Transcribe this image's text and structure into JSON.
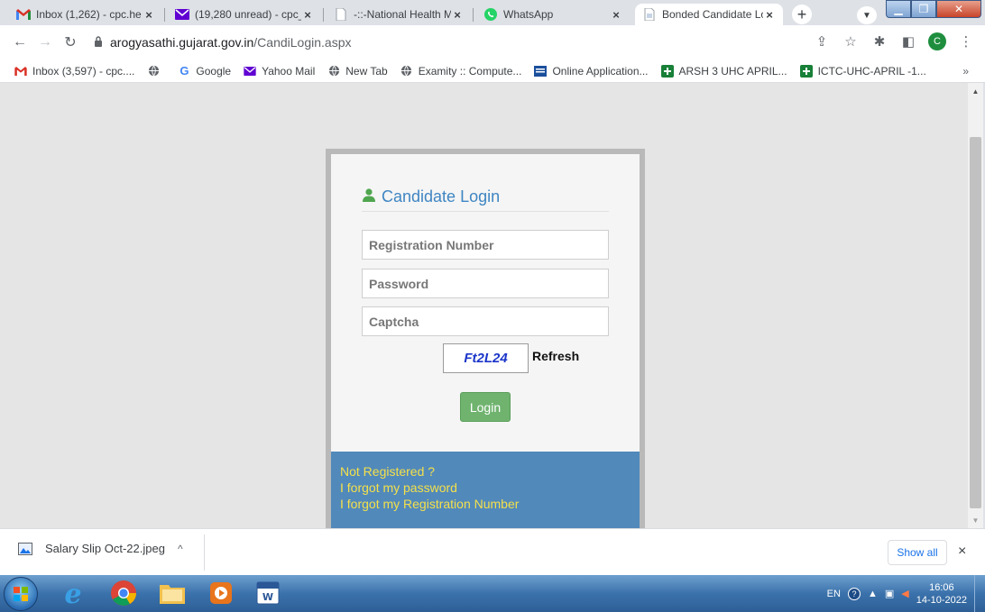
{
  "tabs": [
    {
      "label": "Inbox (1,262) - cpc.he",
      "close": "×",
      "icon": "gmail-icon"
    },
    {
      "label": "(19,280 unread) - cpc_",
      "close": "×",
      "icon": "yahoo-mail-icon"
    },
    {
      "label": "-::-National Health Mi",
      "close": "×",
      "icon": "document-icon"
    },
    {
      "label": "WhatsApp",
      "close": "×",
      "icon": "whatsapp-icon"
    },
    {
      "label": "Bonded Candidate Lo",
      "close": "×",
      "icon": "document-icon"
    }
  ],
  "new_tab": "+",
  "address": {
    "host": "arogyasathi.gujarat.gov.in",
    "path": "/CandiLogin.aspx"
  },
  "profile_initial": "C",
  "bookmarks": [
    {
      "label": "Inbox (3,597) - cpc....",
      "icon": "gmail-icon"
    },
    {
      "label": "",
      "icon": "globe-icon"
    },
    {
      "label": "Google",
      "icon": "google-icon"
    },
    {
      "label": "Yahoo Mail",
      "icon": "yahoo-mail-icon"
    },
    {
      "label": "New Tab",
      "icon": "globe-icon"
    },
    {
      "label": "Examity :: Compute...",
      "icon": "globe-icon"
    },
    {
      "label": "Online Application...",
      "icon": "form-icon"
    },
    {
      "label": "ARSH 3 UHC APRIL...",
      "icon": "sheets-icon"
    },
    {
      "label": "ICTC-UHC-APRIL -1...",
      "icon": "sheets-icon"
    }
  ],
  "bookmarks_more": "»",
  "login": {
    "title": "Candidate Login",
    "registration_placeholder": "Registration Number",
    "password_placeholder": "Password",
    "captcha_placeholder": "Captcha",
    "captcha_text": "Ft2L24",
    "refresh_label": "Refresh",
    "login_label": "Login",
    "links": [
      "Not Registered ?",
      "I forgot my password",
      "I forgot my Registration Number"
    ]
  },
  "downloads": {
    "file": "Salary Slip Oct-22.jpeg",
    "show_all": "Show all",
    "close": "×"
  },
  "tray": {
    "lang": "EN",
    "time": "16:06",
    "date": "14-10-2022"
  },
  "colors": {
    "accent_blue": "#3f85c2",
    "login_green": "#6fb36f",
    "footer_blue": "#5189bb",
    "footer_link": "#f4e04a",
    "captcha_blue": "#1b35c9"
  }
}
